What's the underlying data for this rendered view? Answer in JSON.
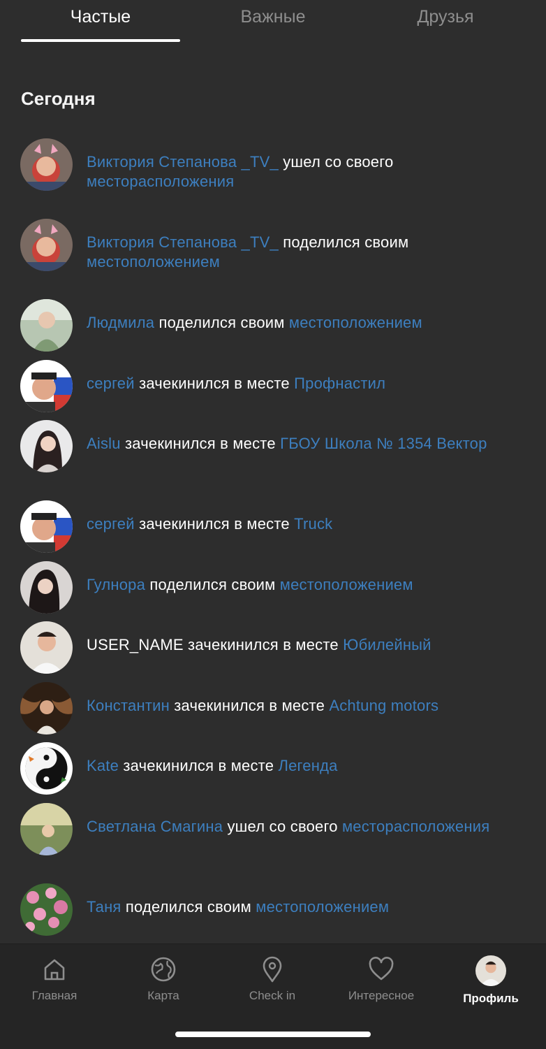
{
  "tabs": [
    {
      "label": "Частые",
      "active": true
    },
    {
      "label": "Важные",
      "active": false
    },
    {
      "label": "Друзья",
      "active": false
    }
  ],
  "section_title": "Сегодня",
  "feed": [
    {
      "name": "Виктория Степанова _TV_",
      "action": "ушел со своего",
      "target": "месторасположения"
    },
    {
      "name": "Виктория Степанова _TV_",
      "action": "поделился своим",
      "target": "местоположением"
    },
    {
      "name": "Людмила",
      "action": "поделился своим",
      "target": "местоположением"
    },
    {
      "name": "сергей",
      "action": "зачекинился в месте",
      "target": "Профнастил"
    },
    {
      "name": "Aislu",
      "action": "зачекинился в месте",
      "target": "ГБОУ Школа № 1354 Вектор"
    },
    {
      "name": "сергей",
      "action": "зачекинился в месте",
      "target": "Truck"
    },
    {
      "name": "Гулнора",
      "action": "поделился своим",
      "target": "местоположением"
    },
    {
      "name": "USER_NAME",
      "action": "зачекинился в месте",
      "target": "Юбилейный"
    },
    {
      "name": "Константин",
      "action": "зачекинился в месте",
      "target": "Achtung motors"
    },
    {
      "name": "Kate",
      "action": "зачекинился в месте",
      "target": "Легенда"
    },
    {
      "name": "Светлана Смагина",
      "action": "ушел со своего",
      "target": "месторасположения"
    },
    {
      "name": "Таня",
      "action": "поделился своим",
      "target": "местоположением"
    }
  ],
  "nav": [
    {
      "label": "Главная",
      "icon": "home-icon",
      "active": false
    },
    {
      "label": "Карта",
      "icon": "globe-icon",
      "active": false
    },
    {
      "label": "Check in",
      "icon": "map-pin-icon",
      "active": false
    },
    {
      "label": "Интересное",
      "icon": "heart-icon",
      "active": false
    },
    {
      "label": "Профиль",
      "icon": "profile-avatar-icon",
      "active": true
    }
  ],
  "colors": {
    "background": "#2d2d2d",
    "link": "#3d7fbf",
    "inactive": "#8e8e8e",
    "bar": "#252525"
  }
}
